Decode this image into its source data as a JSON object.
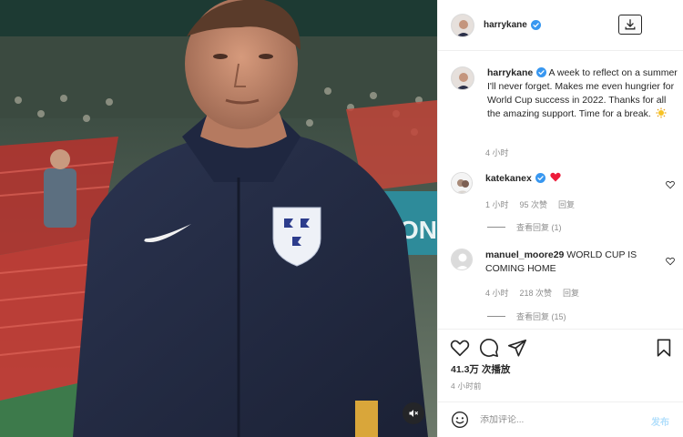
{
  "post": {
    "author": "harrykane",
    "verified": true
  },
  "header": {
    "username": "harrykane",
    "download_icon": "download-icon"
  },
  "caption": {
    "username": "harrykane",
    "text": "A week to reflect on a summer I'll never forget. Makes me even hungrier for World Cup success in 2022. Thanks for all the amazing support. Time for a break.",
    "emoji": "sun-emoji",
    "time": "4 小时"
  },
  "comments": [
    {
      "username": "katekanex",
      "verified": true,
      "text": "",
      "emoji": "red-heart-emoji",
      "time": "1 小时",
      "likes": "95 次赞",
      "reply": "回复",
      "view_replies": "查看回复 (1)"
    },
    {
      "username": "manuel_moore29",
      "verified": false,
      "text": "WORLD CUP IS COMING HOME",
      "time": "4 小时",
      "likes": "218 次赞",
      "reply": "回复",
      "view_replies": "查看回复 (15)"
    }
  ],
  "actions": {
    "views": "41.3万 次播放",
    "post_time": "4 小时前"
  },
  "add_comment": {
    "placeholder": "添加评论...",
    "post_label": "发布"
  },
  "colors": {
    "accent_blue": "#0095f6",
    "verified_blue": "#3897f0",
    "heart_red": "#ed4956",
    "text_dark": "#262626",
    "text_muted": "#8e8e8e"
  }
}
